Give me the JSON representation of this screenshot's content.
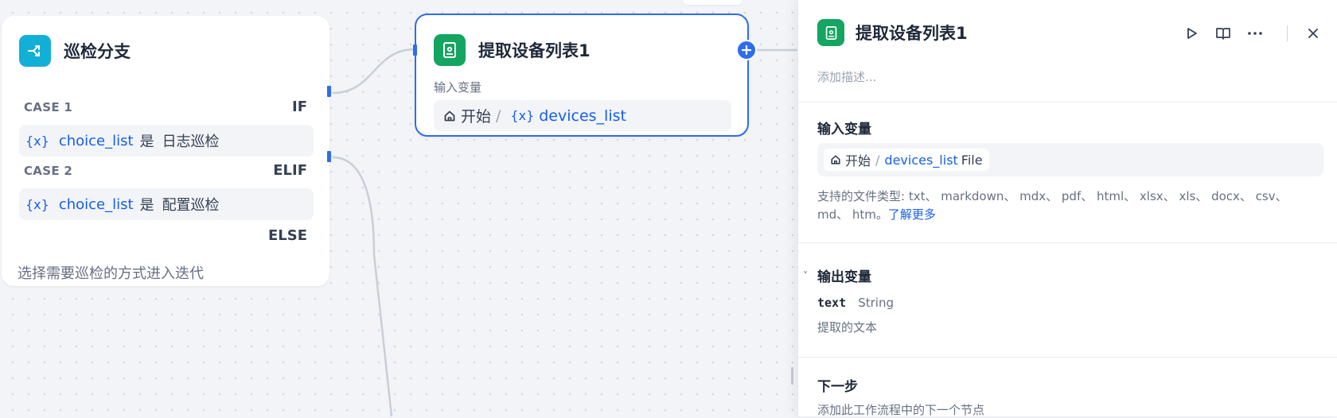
{
  "branch_node": {
    "title": "巡检分支",
    "cases": [
      {
        "label": "CASE 1",
        "keyword": "IF",
        "var_symbol": "{x}",
        "variable": "choice_list",
        "operator": "是",
        "value": "日志巡检"
      },
      {
        "label": "CASE 2",
        "keyword": "ELIF",
        "var_symbol": "{x}",
        "variable": "choice_list",
        "operator": "是",
        "value": "配置巡检"
      }
    ],
    "else_keyword": "ELSE",
    "description": "选择需要巡检的方式进入迭代"
  },
  "extract_node": {
    "title": "提取设备列表1",
    "input_label": "输入变量",
    "ref": {
      "source": "开始",
      "separator": "/",
      "var_symbol": "{x}",
      "variable": "devices_list"
    }
  },
  "panel": {
    "title": "提取设备列表1",
    "description_placeholder": "添加描述...",
    "input_section": {
      "title": "输入变量",
      "ref": {
        "source": "开始",
        "separator": "/",
        "variable": "devices_list",
        "type": "File"
      },
      "supported_types": "支持的文件类型: txt、 markdown、 mdx、 pdf、 html、 xlsx、 xls、 docx、 csv、 md、 htm。",
      "learn_more": "了解更多"
    },
    "output_section": {
      "title": "输出变量",
      "chevron": "˅",
      "outputs": [
        {
          "name": "text",
          "type": "String",
          "description": "提取的文本"
        }
      ]
    },
    "next_section": {
      "title": "下一步",
      "subtitle": "添加此工作流程中的下一个节点"
    }
  },
  "icons": {
    "branch": "branch-icon",
    "document": "document-icon",
    "home": "home-icon",
    "run": "play-icon",
    "docs": "book-open-icon",
    "more": "more-icon",
    "close": "close-icon",
    "add": "plus-icon"
  },
  "colors": {
    "accent": "#2e6cf0",
    "link": "#155eef",
    "branch_icon": "#12b0d6",
    "doc_icon": "#14a561"
  }
}
